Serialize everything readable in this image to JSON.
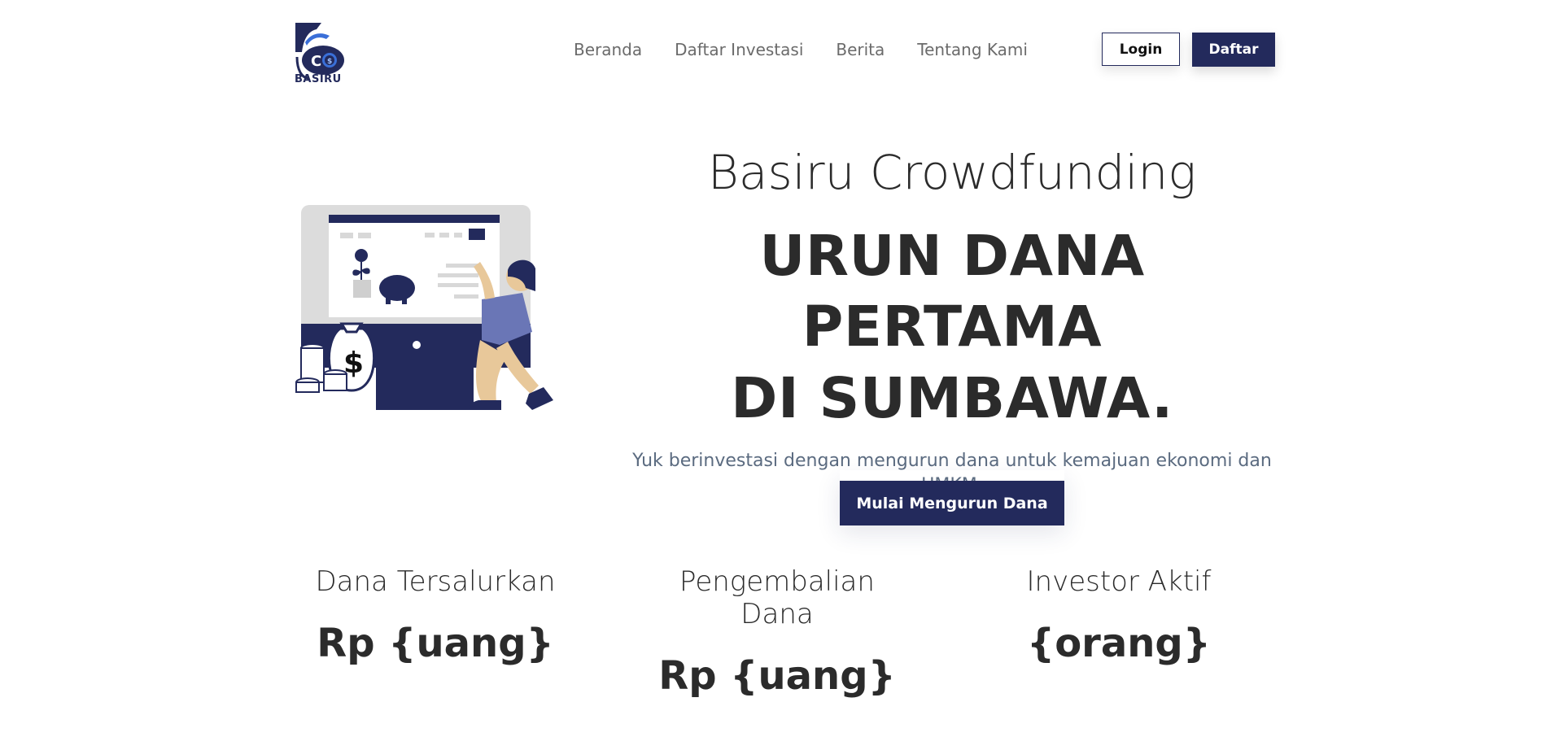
{
  "brand": {
    "name": "BASIRU",
    "logo_icon": "basiru-co-logo-icon"
  },
  "nav": {
    "items": [
      {
        "label": "Beranda"
      },
      {
        "label": "Daftar Investasi"
      },
      {
        "label": "Berita"
      },
      {
        "label": "Tentang Kami"
      }
    ]
  },
  "auth": {
    "login_label": "Login",
    "register_label": "Daftar"
  },
  "hero": {
    "brand_title": "Basiru Crowdfunding",
    "headline_line1": "URUN DANA PERTAMA",
    "headline_line2": "DI SUMBAWA.",
    "description": "Yuk berinvestasi dengan mengurun dana untuk kemajuan ekonomi dan UMKM.",
    "cta_label": "Mulai Mengurun Dana",
    "illustration_icon": "investment-illustration-icon"
  },
  "stats": [
    {
      "label": "Dana Tersalurkan",
      "value": "Rp {uang}"
    },
    {
      "label": "Pengembalian Dana",
      "value": "Rp {uang}"
    },
    {
      "label": "Investor Aktif",
      "value": "{orang}"
    }
  ],
  "colors": {
    "primary": "#232a5c",
    "text": "#2b2b2b",
    "muted": "#6b6b6b",
    "desc": "#5b6b80"
  }
}
